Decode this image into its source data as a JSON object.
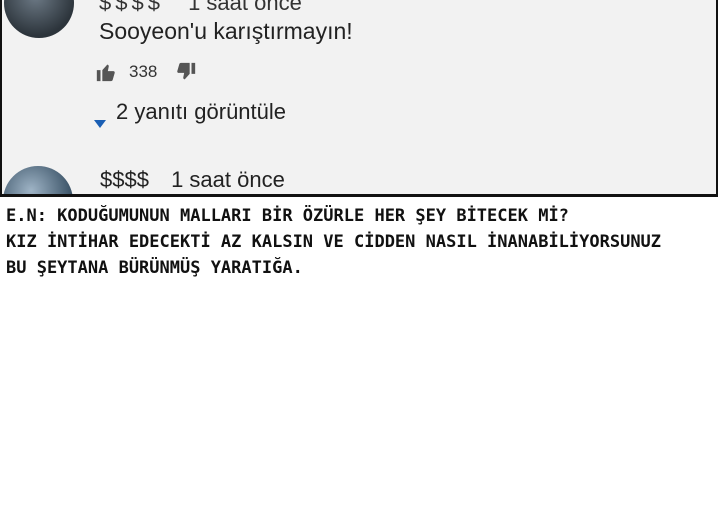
{
  "comments": {
    "top": {
      "username": "$$$$",
      "time": "1 saat önce",
      "text": "Sooyeon'u karıştırmayın!",
      "likes": "338",
      "replies_label": "2 yanıtı görüntüle"
    },
    "bottom": {
      "username": "$$$$",
      "time": "1 saat önce"
    }
  },
  "note": {
    "lines": [
      "E.N: KODUĞUMUNUN MALLARI BİR ÖZÜRLE HER ŞEY BİTECEK Mİ?",
      "KIZ İNTİHAR EDECEKTİ AZ KALSIN VE CİDDEN NASIL İNANABİLİYORSUNUZ",
      "BU ŞEYTANA BÜRÜNMÜŞ YARATIĞA."
    ]
  },
  "colors": {
    "panel_bg": "#f2f2f2",
    "border": "#111111",
    "accent": "#1a5fb4"
  }
}
